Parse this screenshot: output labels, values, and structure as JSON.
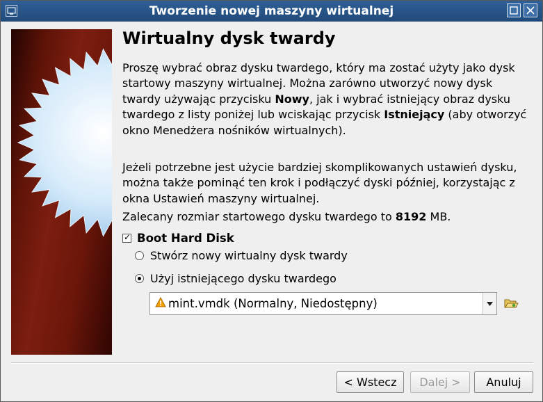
{
  "window": {
    "title": "Tworzenie nowej maszyny wirtualnej",
    "app_icon": "virtualbox-icon",
    "controls": [
      "maximize-icon",
      "close-icon"
    ],
    "titlebar_color": "#214a79"
  },
  "page": {
    "heading": "Wirtualny dysk twardy",
    "p1": {
      "t1": "Proszę wybrać obraz dysku twardego, który ma zostać użyty jako dysk startowy maszyny wirtualnej. Można zarówno utworzyć nowy dysk twardy używając przycisku ",
      "b1": "Nowy",
      "t2": ", jak i wybrać istniejący obraz dysku twardego z listy poniżej lub wciskając przycisk ",
      "b2": "Istniejący",
      "t3": " (aby otworzyć okno Menedżera nośników wirtualnych)."
    },
    "p2": "Jeżeli potrzebne jest użycie bardziej skomplikowanych ustawień dysku, można także pominąć ten krok i podłączyć dyski później, korzystając z okna Ustawień maszyny wirtualnej.",
    "p3": {
      "t1": "Zalecany rozmiar startowego dysku twardego to ",
      "size": "8192",
      "t2": " MB."
    },
    "boot_disk": {
      "label": "Boot Hard Disk",
      "checked": true
    },
    "options": [
      {
        "label": "Stwórz nowy wirtualny dysk twardy",
        "selected": false
      },
      {
        "label": "Użyj istniejącego dysku twardego",
        "selected": true
      }
    ],
    "disk_select": {
      "value": "mint.vmdk (Normalny, Niedostępny)",
      "status_icon": "warning-icon",
      "status_color": "#f0a000"
    },
    "folder_button_icon": "folder-open-icon"
  },
  "buttons": {
    "back": "< Wstecz",
    "next": "Dalej >",
    "next_enabled": false,
    "cancel": "Anuluj"
  },
  "side_image": {
    "background_color": "#7c1e10",
    "star_color": "#bfe0f8"
  }
}
